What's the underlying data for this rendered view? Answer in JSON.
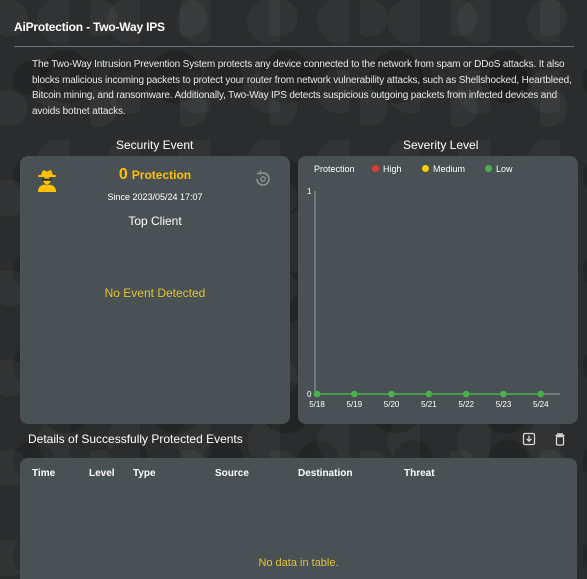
{
  "page": {
    "title": "AiProtection - Two-Way IPS",
    "description": "The Two-Way Intrusion Prevention System protects any device connected to the network from spam or DDoS attacks. It also blocks malicious incoming packets to protect your router from network vulnerability attacks, such as Shellshocked, Heartbleed, Bitcoin mining, and ransomware. Additionally, Two-Way IPS detects suspicious outgoing packets from infected devices and avoids botnet attacks."
  },
  "security_event": {
    "heading": "Security Event",
    "count": "0",
    "count_label": "Protection",
    "since": "Since 2023/05/24 17:07",
    "top_client_label": "Top Client",
    "empty_message": "No Event Detected",
    "icons": [
      "spy-icon",
      "reset-icon"
    ],
    "accent_color": "#ffc000"
  },
  "severity_level": {
    "heading": "Severity Level",
    "legend": [
      {
        "label": "Protection",
        "color": ""
      },
      {
        "label": "High",
        "color": "#e53935"
      },
      {
        "label": "Medium",
        "color": "#f5d000"
      },
      {
        "label": "Low",
        "color": "#4caf50"
      }
    ]
  },
  "chart_data": {
    "type": "line",
    "categories": [
      "5/18",
      "5/19",
      "5/20",
      "5/21",
      "5/22",
      "5/23",
      "5/24"
    ],
    "series": [
      {
        "name": "Low",
        "color": "#4caf50",
        "values": [
          0,
          0,
          0,
          0,
          0,
          0,
          0
        ]
      }
    ],
    "y_ticks": [
      "0",
      "1"
    ],
    "ylim": [
      0,
      1
    ],
    "grid": false,
    "legend_position": "top"
  },
  "details": {
    "heading": "Details of Successfully Protected Events",
    "icons": [
      "export-icon",
      "delete-icon"
    ],
    "columns": [
      "Time",
      "Level",
      "Type",
      "Source",
      "Destination",
      "Threat"
    ],
    "empty_message": "No data in table."
  }
}
